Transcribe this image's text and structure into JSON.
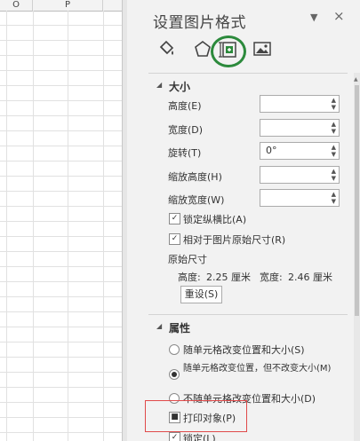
{
  "sheet": {
    "columns": [
      "O",
      "P"
    ]
  },
  "pane": {
    "title": "设置图片格式",
    "dropdown_glyph": "▼",
    "close_glyph": "×",
    "tabs": [
      {
        "name": "fill-line",
        "icon": "paint-bucket-icon"
      },
      {
        "name": "effects",
        "icon": "pentagon-icon"
      },
      {
        "name": "size-properties",
        "icon": "size-properties-icon",
        "active": true
      },
      {
        "name": "picture",
        "icon": "picture-icon"
      }
    ],
    "size_section": {
      "title": "大小",
      "fields": [
        {
          "label": "高度(E)",
          "value": ""
        },
        {
          "label": "宽度(D)",
          "value": ""
        },
        {
          "label": "旋转(T)",
          "value": "0°"
        },
        {
          "label": "缩放高度(H)",
          "value": ""
        },
        {
          "label": "缩放宽度(W)",
          "value": ""
        }
      ],
      "lock_aspect": {
        "label": "锁定纵横比(A)",
        "checked": true
      },
      "relative_original": {
        "label": "相对于图片原始尺寸(R)",
        "checked": true
      },
      "original_size_label": "原始尺寸",
      "original_height_label": "高度:",
      "original_height_value": "2.25 厘米",
      "original_width_label": "宽度:",
      "original_width_value": "2.46 厘米",
      "reset_button": "重设(S)"
    },
    "properties_section": {
      "title": "属性",
      "options": [
        {
          "label": "随单元格改变位置和大小(S)",
          "selected": false
        },
        {
          "label": "随单元格改变位置，但不改变大小(M)",
          "selected": true
        },
        {
          "label": "不随单元格改变位置和大小(D)",
          "selected": false
        }
      ],
      "print_object": {
        "label": "打印对象(P)",
        "checked": true
      },
      "locked": {
        "label": "锁定(L)",
        "checked": true
      }
    }
  },
  "colors": {
    "accent_ring": "#2c8a3c",
    "highlight_border": "#e04a4a"
  }
}
